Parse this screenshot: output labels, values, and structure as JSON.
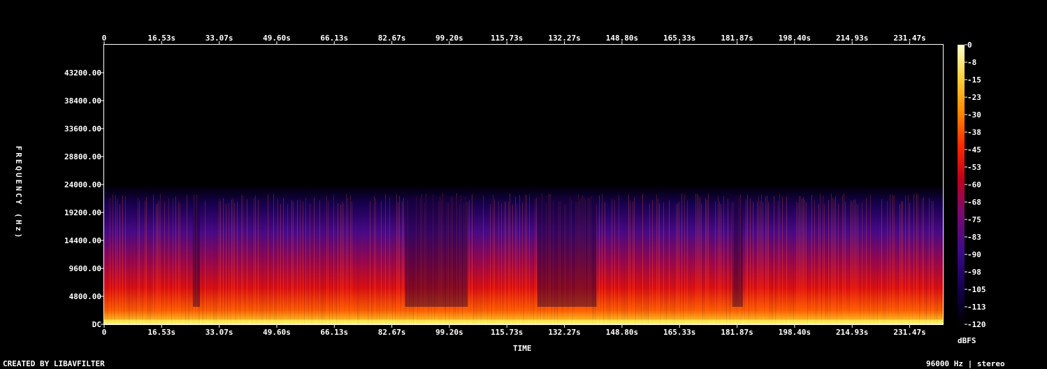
{
  "footer": {
    "left": "CREATED BY LIBAVFILTER",
    "right": "96000 Hz | stereo"
  },
  "chart_data": {
    "type": "heatmap",
    "title": "",
    "xlabel": "TIME",
    "ylabel": "FREQUENCY (Hz)",
    "colorbar_label": "dBFS",
    "x_ticks": [
      "0",
      "16.53s",
      "33.07s",
      "49.60s",
      "66.13s",
      "82.67s",
      "99.20s",
      "115.73s",
      "132.27s",
      "148.80s",
      "165.33s",
      "181.87s",
      "198.40s",
      "214.93s",
      "231.47s"
    ],
    "x_tick_values": [
      0,
      16.53,
      33.07,
      49.6,
      66.13,
      82.67,
      99.2,
      115.73,
      132.27,
      148.8,
      165.33,
      181.87,
      198.4,
      214.93,
      231.47
    ],
    "xlim": [
      0,
      241
    ],
    "y_ticks": [
      "DC",
      "4800.00",
      "9600.00",
      "14400.00",
      "19200.00",
      "24000.00",
      "28800.00",
      "33600.00",
      "38400.00",
      "43200.00"
    ],
    "y_tick_values": [
      0,
      4800,
      9600,
      14400,
      19200,
      24000,
      28800,
      33600,
      38400,
      43200
    ],
    "ylim": [
      0,
      48000
    ],
    "colorbar_ticks": [
      "0",
      "-8",
      "-15",
      "-23",
      "-30",
      "-38",
      "-45",
      "-53",
      "-60",
      "-68",
      "-75",
      "-83",
      "-90",
      "-98",
      "-105",
      "-113",
      "-120"
    ],
    "colorbar_values": [
      0,
      -7.5,
      -15,
      -22.5,
      -30,
      -37.5,
      -45,
      -52.5,
      -60,
      -67.5,
      -75,
      -82.5,
      -90,
      -97.5,
      -105,
      -112.5,
      -120
    ],
    "zlim": [
      -120,
      0
    ],
    "content_cutoff_hz": 22000,
    "colormap": [
      "#000000",
      "#12004a",
      "#3a0a8a",
      "#7a0a70",
      "#c0001a",
      "#ff2a00",
      "#ff8a00",
      "#ffd03a",
      "#ffffc8"
    ],
    "quiet_segments_s": [
      [
        25.5,
        27.5
      ],
      [
        86.5,
        104.5
      ],
      [
        124.5,
        141.5
      ],
      [
        180.5,
        183.5
      ]
    ]
  }
}
